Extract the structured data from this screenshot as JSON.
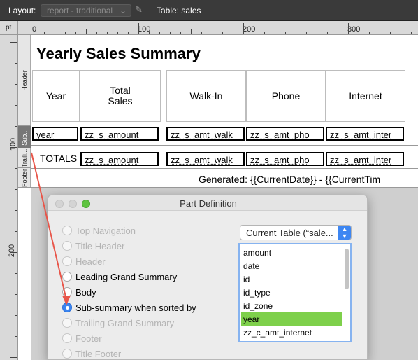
{
  "toolbar": {
    "layout_label": "Layout:",
    "layout_value": "report - traditional",
    "table_label": "Table: sales"
  },
  "ruler": {
    "unit": "pt",
    "h_numbers": [
      "0",
      "100",
      "200",
      "300"
    ],
    "v_numbers": [
      "100",
      "200"
    ]
  },
  "parts": [
    "Header",
    "Sub...",
    "Traili...",
    "Footer"
  ],
  "report": {
    "title": "Yearly Sales Summary",
    "headers": [
      "Year",
      "Total\nSales",
      "Walk-In",
      "Phone",
      "Internet"
    ],
    "sub_fields": [
      "year",
      "zz_s_amount",
      "zz_s_amt_walk",
      "zz_s_amt_pho",
      "zz_s_amt_inter"
    ],
    "totals_label": "TOTALS",
    "total_fields": [
      "zz_s_amount",
      "zz_s_amt_walk",
      "zz_s_amt_pho",
      "zz_s_amt_inter"
    ],
    "generated": "Generated: {{CurrentDate}} - {{CurrentTim"
  },
  "dialog": {
    "title": "Part Definition",
    "options": [
      {
        "label": "Top Navigation",
        "state": "disabled"
      },
      {
        "label": "Title Header",
        "state": "disabled"
      },
      {
        "label": "Header",
        "state": "disabled"
      },
      {
        "label": "Leading Grand Summary",
        "state": "enabled"
      },
      {
        "label": "Body",
        "state": "enabled"
      },
      {
        "label": "Sub-summary when sorted by",
        "state": "checked"
      },
      {
        "label": "Trailing Grand Summary",
        "state": "disabled"
      },
      {
        "label": "Footer",
        "state": "disabled"
      },
      {
        "label": "Title Footer",
        "state": "disabled"
      }
    ],
    "table_select": "Current Table (“sale...",
    "fields": [
      "amount",
      "date",
      "id",
      "id_type",
      "id_zone",
      "year",
      "zz_c_amt_internet"
    ],
    "selected_field": "year",
    "colors": {
      "selection": "#7ed04b",
      "accent": "#3a84f0",
      "arrow": "#e8564a"
    }
  }
}
